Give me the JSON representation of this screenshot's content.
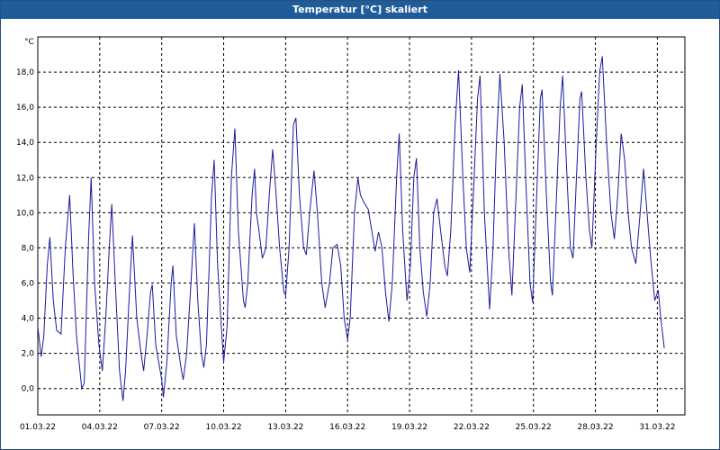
{
  "window": {
    "title": "Temperatur [°C] skaliert"
  },
  "chart_data": {
    "type": "line",
    "title": "Temperatur [°C] skaliert",
    "ylabel": "°C",
    "xlabel": "",
    "grid": true,
    "ylim": [
      -1.5,
      20.0
    ],
    "xlim": [
      "01.03.22",
      "01.04.22 08:00"
    ],
    "x_ticks": [
      "01.03.22",
      "04.03.22",
      "07.03.22",
      "10.03.22",
      "13.03.22",
      "16.03.22",
      "19.03.22",
      "22.03.22",
      "25.03.22",
      "28.03.22",
      "31.03.22"
    ],
    "y_ticks": [
      "0,0",
      "2,0",
      "4,0",
      "6,0",
      "8,0",
      "10,0",
      "12,0",
      "14,0",
      "16,0",
      "18,0"
    ],
    "series": [
      {
        "color": "#1a1aa0",
        "points": [
          [
            "01.03.22 00:00",
            3.5
          ],
          [
            "01.03.22 04:00",
            1.8
          ],
          [
            "01.03.22 07:00",
            3.0
          ],
          [
            "01.03.22 11:00",
            7.0
          ],
          [
            "01.03.22 14:00",
            8.6
          ],
          [
            "01.03.22 18:00",
            5.0
          ],
          [
            "01.03.22 22:00",
            3.3
          ],
          [
            "02.03.22 03:00",
            3.1
          ],
          [
            "02.03.22 08:00",
            8.0
          ],
          [
            "02.03.22 13:00",
            11.0
          ],
          [
            "02.03.22 17:00",
            6.5
          ],
          [
            "02.03.22 21:00",
            3.0
          ],
          [
            "03.03.22 03:00",
            0.0
          ],
          [
            "03.03.22 06:00",
            0.3
          ],
          [
            "03.03.22 11:00",
            8.5
          ],
          [
            "03.03.22 14:00",
            12.0
          ],
          [
            "03.03.22 18:00",
            6.0
          ],
          [
            "03.03.22 23:00",
            2.5
          ],
          [
            "04.03.22 03:00",
            1.0
          ],
          [
            "04.03.22 07:00",
            4.0
          ],
          [
            "04.03.22 11:00",
            8.0
          ],
          [
            "04.03.22 14:00",
            10.5
          ],
          [
            "04.03.22 18:00",
            6.0
          ],
          [
            "04.03.22 23:00",
            1.0
          ],
          [
            "05.03.22 03:00",
            -0.7
          ],
          [
            "05.03.22 06:00",
            1.0
          ],
          [
            "05.03.22 11:00",
            6.0
          ],
          [
            "05.03.22 14:00",
            8.7
          ],
          [
            "05.03.22 19:00",
            4.0
          ],
          [
            "06.03.22 00:00",
            2.0
          ],
          [
            "06.03.22 03:00",
            1.0
          ],
          [
            "06.03.22 07:00",
            3.0
          ],
          [
            "06.03.22 11:00",
            5.5
          ],
          [
            "06.03.22 13:00",
            5.9
          ],
          [
            "06.03.22 17:00",
            2.5
          ],
          [
            "07.03.22 00:00",
            0.5
          ],
          [
            "07.03.22 02:00",
            -0.5
          ],
          [
            "07.03.22 06:00",
            1.5
          ],
          [
            "07.03.22 11:00",
            6.0
          ],
          [
            "07.03.22 13:00",
            7.0
          ],
          [
            "07.03.22 17:00",
            3.0
          ],
          [
            "07.03.22 23:00",
            1.0
          ],
          [
            "08.03.22 01:00",
            0.5
          ],
          [
            "08.03.22 05:00",
            2.0
          ],
          [
            "08.03.22 10:00",
            6.0
          ],
          [
            "08.03.22 14:00",
            9.4
          ],
          [
            "08.03.22 18:00",
            5.0
          ],
          [
            "08.03.22 22:00",
            2.0
          ],
          [
            "09.03.22 01:00",
            1.2
          ],
          [
            "09.03.22 04:00",
            2.5
          ],
          [
            "09.03.22 10:00",
            11.0
          ],
          [
            "09.03.22 13:00",
            13.0
          ],
          [
            "09.03.22 17:00",
            7.0
          ],
          [
            "09.03.22 22:00",
            3.0
          ],
          [
            "10.03.22 00:00",
            1.5
          ],
          [
            "10.03.22 04:00",
            3.5
          ],
          [
            "10.03.22 09:00",
            12.0
          ],
          [
            "10.03.22 13:00",
            14.8
          ],
          [
            "10.03.22 17:00",
            9.0
          ],
          [
            "10.03.22 23:00",
            5.0
          ],
          [
            "11.03.22 01:00",
            4.6
          ],
          [
            "11.03.22 04:00",
            6.0
          ],
          [
            "11.03.22 09:00",
            11.0
          ],
          [
            "11.03.22 12:00",
            12.5
          ],
          [
            "11.03.22 14:00",
            10.0
          ],
          [
            "11.03.22 17:00",
            9.0
          ],
          [
            "11.03.22 21:00",
            7.4
          ],
          [
            "12.03.22 01:00",
            8.0
          ],
          [
            "12.03.22 05:00",
            11.0
          ],
          [
            "12.03.22 09:00",
            13.6
          ],
          [
            "12.03.22 13:00",
            11.0
          ],
          [
            "12.03.22 17:00",
            8.0
          ],
          [
            "12.03.22 22:00",
            5.5
          ],
          [
            "13.03.22 00:00",
            5.3
          ],
          [
            "13.03.22 04:00",
            8.0
          ],
          [
            "13.03.22 09:00",
            15.0
          ],
          [
            "13.03.22 12:00",
            15.4
          ],
          [
            "13.03.22 16:00",
            11.0
          ],
          [
            "13.03.22 21:00",
            8.0
          ],
          [
            "14.03.22 00:00",
            7.6
          ],
          [
            "14.03.22 04:00",
            10.0
          ],
          [
            "14.03.22 09:00",
            12.4
          ],
          [
            "14.03.22 13:00",
            10.0
          ],
          [
            "14.03.22 18:00",
            6.0
          ],
          [
            "14.03.22 22:00",
            4.6
          ],
          [
            "15.03.22 03:00",
            6.0
          ],
          [
            "15.03.22 07:00",
            8.0
          ],
          [
            "15.03.22 12:00",
            8.2
          ],
          [
            "15.03.22 16:00",
            7.0
          ],
          [
            "15.03.22 20:00",
            4.0
          ],
          [
            "16.03.22 00:00",
            2.8
          ],
          [
            "16.03.22 03:00",
            4.0
          ],
          [
            "16.03.22 08:00",
            10.0
          ],
          [
            "16.03.22 12:00",
            12.0
          ],
          [
            "16.03.22 15:00",
            11.0
          ],
          [
            "16.03.22 20:00",
            10.5
          ],
          [
            "17.03.22 00:00",
            10.2
          ],
          [
            "17.03.22 04:00",
            9.0
          ],
          [
            "17.03.22 08:00",
            7.8
          ],
          [
            "17.03.22 12:00",
            8.9
          ],
          [
            "17.03.22 16:00",
            8.0
          ],
          [
            "17.03.22 20:00",
            5.5
          ],
          [
            "18.03.22 00:00",
            3.8
          ],
          [
            "18.03.22 04:00",
            6.0
          ],
          [
            "18.03.22 09:00",
            12.0
          ],
          [
            "18.03.22 12:00",
            14.5
          ],
          [
            "18.03.22 16:00",
            9.0
          ],
          [
            "18.03.22 21:00",
            5.0
          ],
          [
            "19.03.22 01:00",
            7.0
          ],
          [
            "19.03.22 05:00",
            12.0
          ],
          [
            "19.03.22 08:00",
            13.1
          ],
          [
            "19.03.22 12:00",
            8.0
          ],
          [
            "19.03.22 16:00",
            5.5
          ],
          [
            "19.03.22 20:00",
            4.1
          ],
          [
            "20.03.22 00:00",
            6.0
          ],
          [
            "20.03.22 04:00",
            10.0
          ],
          [
            "20.03.22 08:00",
            10.8
          ],
          [
            "20.03.22 12:00",
            9.0
          ],
          [
            "20.03.22 17:00",
            7.0
          ],
          [
            "20.03.22 20:00",
            6.4
          ],
          [
            "21.03.22 00:00",
            9.0
          ],
          [
            "21.03.22 05:00",
            15.0
          ],
          [
            "21.03.22 09:00",
            18.1
          ],
          [
            "21.03.22 14:00",
            12.0
          ],
          [
            "21.03.22 18:00",
            8.0
          ],
          [
            "21.03.22 22:00",
            6.6
          ],
          [
            "22.03.22 03:00",
            12.0
          ],
          [
            "22.03.22 07:00",
            16.5
          ],
          [
            "22.03.22 10:00",
            17.8
          ],
          [
            "22.03.22 15:00",
            10.0
          ],
          [
            "22.03.22 21:00",
            4.5
          ],
          [
            "23.03.22 01:00",
            8.0
          ],
          [
            "23.03.22 05:00",
            14.0
          ],
          [
            "23.03.22 09:00",
            17.9
          ],
          [
            "23.03.22 14:00",
            14.0
          ],
          [
            "23.03.22 19:00",
            8.0
          ],
          [
            "23.03.22 23:00",
            5.3
          ],
          [
            "24.03.22 03:00",
            10.0
          ],
          [
            "24.03.22 08:00",
            16.0
          ],
          [
            "24.03.22 11:00",
            17.3
          ],
          [
            "24.03.22 15:00",
            12.0
          ],
          [
            "24.03.22 20:00",
            6.0
          ],
          [
            "24.03.22 23:00",
            4.9
          ],
          [
            "25.03.22 03:00",
            10.0
          ],
          [
            "25.03.22 08:00",
            16.5
          ],
          [
            "25.03.22 10:00",
            17.0
          ],
          [
            "25.03.22 15:00",
            11.0
          ],
          [
            "25.03.22 20:00",
            6.0
          ],
          [
            "25.03.22 22:00",
            5.3
          ],
          [
            "26.03.22 02:00",
            10.0
          ],
          [
            "26.03.22 07:00",
            16.0
          ],
          [
            "26.03.22 10:00",
            17.8
          ],
          [
            "26.03.22 15:00",
            12.0
          ],
          [
            "26.03.22 19:00",
            8.0
          ],
          [
            "26.03.22 22:00",
            7.4
          ],
          [
            "27.03.22 02:00",
            12.0
          ],
          [
            "27.03.22 06:00",
            16.5
          ],
          [
            "27.03.22 08:00",
            16.9
          ],
          [
            "27.03.22 13:00",
            12.0
          ],
          [
            "27.03.22 17:00",
            9.0
          ],
          [
            "27.03.22 20:00",
            8.0
          ],
          [
            "28.03.22 01:00",
            14.0
          ],
          [
            "28.03.22 05:00",
            18.0
          ],
          [
            "28.03.22 08:00",
            18.9
          ],
          [
            "28.03.22 13:00",
            14.0
          ],
          [
            "28.03.22 18:00",
            10.0
          ],
          [
            "28.03.22 22:00",
            8.5
          ],
          [
            "29.03.22 02:00",
            11.0
          ],
          [
            "29.03.22 06:00",
            14.5
          ],
          [
            "29.03.22 10:00",
            13.0
          ],
          [
            "29.03.22 14:00",
            10.0
          ],
          [
            "29.03.22 18:00",
            8.0
          ],
          [
            "29.03.22 23:00",
            7.1
          ],
          [
            "30.03.22 04:00",
            10.0
          ],
          [
            "30.03.22 08:00",
            12.5
          ],
          [
            "30.03.22 12:00",
            10.0
          ],
          [
            "30.03.22 16:00",
            7.5
          ],
          [
            "30.03.22 21:00",
            5.0
          ],
          [
            "31.03.22 01:00",
            5.6
          ],
          [
            "31.03.22 04:00",
            4.0
          ],
          [
            "31.03.22 08:00",
            2.3
          ]
        ]
      }
    ]
  }
}
